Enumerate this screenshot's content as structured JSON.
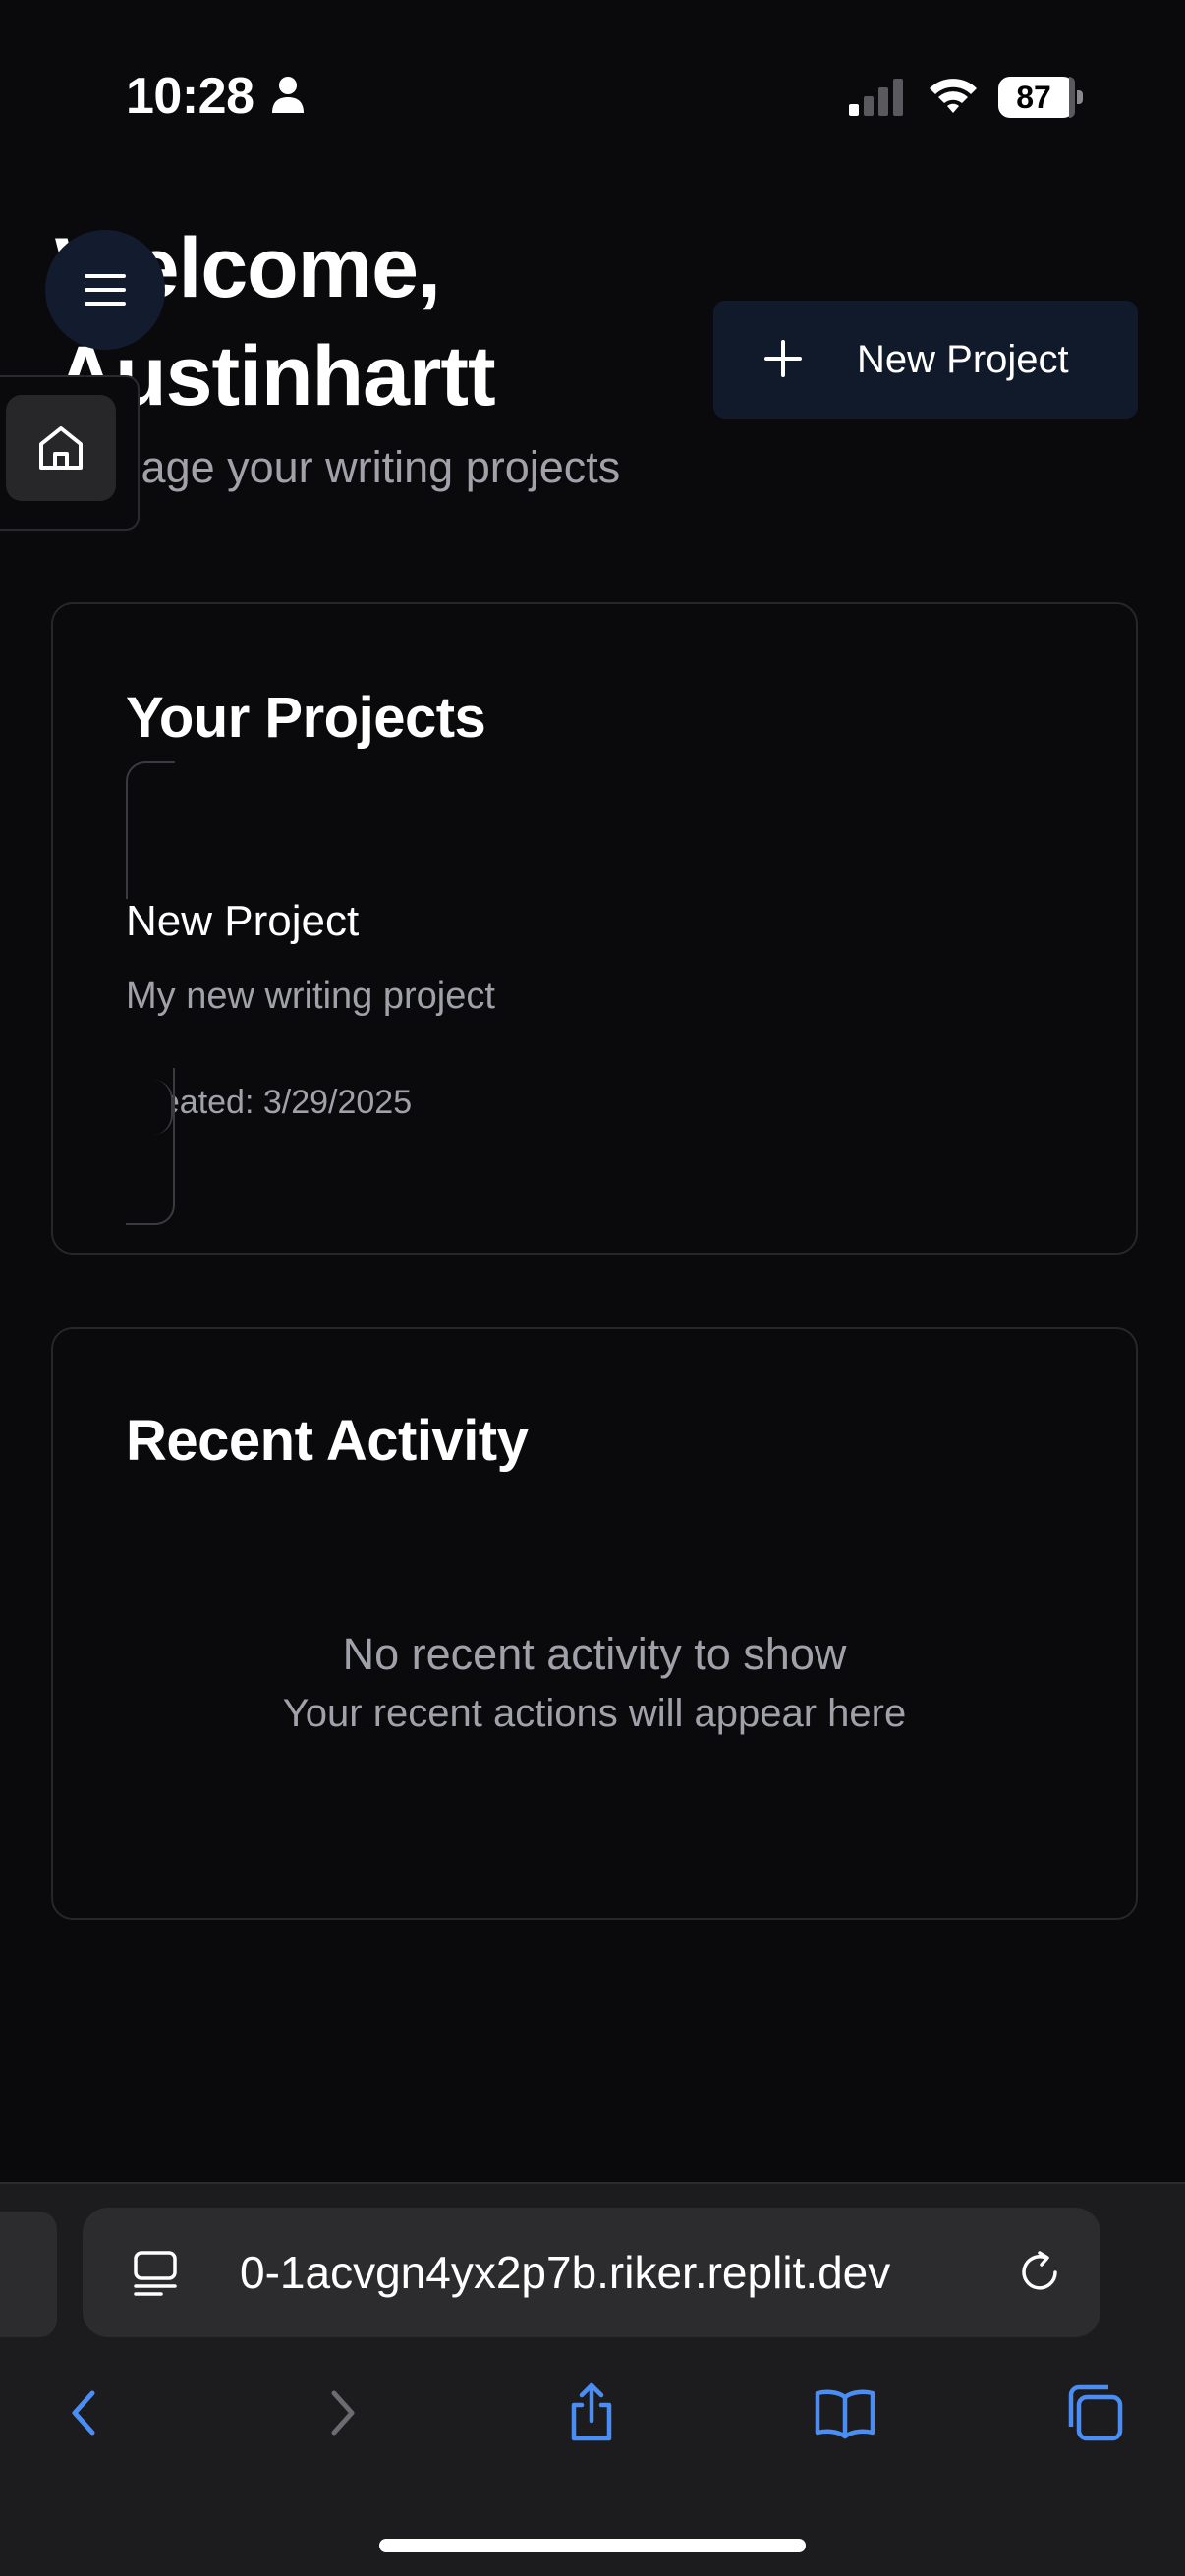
{
  "status_bar": {
    "time": "10:28",
    "battery": "87",
    "icons": [
      "person-icon",
      "cellular-signal-icon",
      "wifi-icon",
      "battery-icon"
    ]
  },
  "header": {
    "welcome_line1": "Welcome,",
    "welcome_line2": "Austinhartt",
    "subtitle": "Manage your writing projects",
    "new_project_label": "New Project"
  },
  "projects": {
    "title": "Your Projects",
    "items": [
      {
        "name": "New Project",
        "description": "My new writing project",
        "created": "Created: 3/29/2025"
      }
    ]
  },
  "activity": {
    "title": "Recent Activity",
    "empty_title": "No recent activity to show",
    "empty_subtitle": "Your recent actions will appear here"
  },
  "browser": {
    "url": "0-1acvgn4yx2p7b.riker.replit.dev",
    "toolbar": [
      "back-icon",
      "forward-icon",
      "share-icon",
      "bookmarks-icon",
      "tabs-icon"
    ]
  },
  "colors": {
    "background": "#0a0a0c",
    "card_border": "#27272a",
    "muted_text": "#a1a1aa",
    "primary_button": "#111a2b",
    "link_blue": "#4a8ef5"
  }
}
